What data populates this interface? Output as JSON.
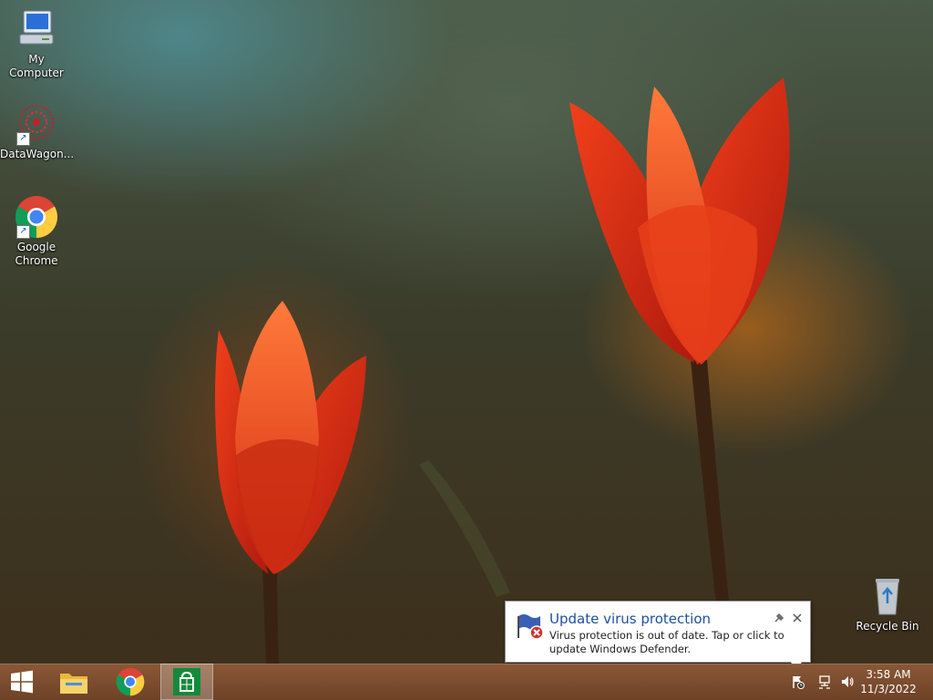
{
  "desktop": {
    "icons": [
      {
        "label": "My Computer",
        "icon": "computer-icon"
      },
      {
        "label": "DataWagon...",
        "icon": "datawagon-icon"
      },
      {
        "label": "Google Chrome",
        "icon": "chrome-icon"
      },
      {
        "label": "Recycle Bin",
        "icon": "recycle-bin-icon"
      }
    ]
  },
  "notification": {
    "title": "Update virus protection",
    "message": "Virus protection is out of date. Tap or click to update Windows Defender.",
    "icon": "defender-warning-icon"
  },
  "taskbar": {
    "start_icon": "windows-start-icon",
    "pinned": [
      {
        "name": "File Explorer",
        "icon": "file-explorer-icon"
      },
      {
        "name": "Google Chrome",
        "icon": "chrome-icon"
      },
      {
        "name": "Store",
        "icon": "store-icon",
        "active": true
      }
    ],
    "tray": [
      "action-center-flag-icon",
      "network-icon",
      "volume-icon"
    ],
    "clock": {
      "time": "3:58 AM",
      "date": "11/3/2022"
    }
  },
  "colors": {
    "taskbar": "#7a4c2f",
    "notification_title": "#1f4fa0"
  }
}
